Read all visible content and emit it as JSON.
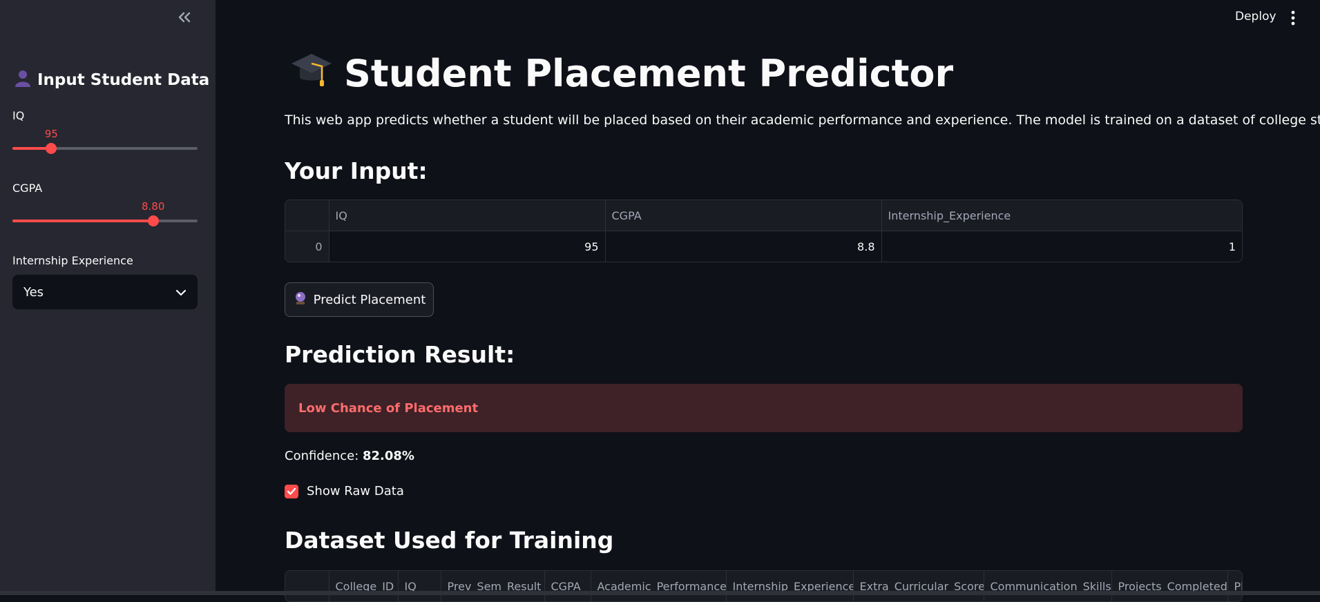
{
  "sidebar": {
    "title": "Input Student Data",
    "title_icon": "bust-silhouette-icon",
    "iq": {
      "label": "IQ",
      "value": "95",
      "fraction": 0.21
    },
    "cgpa": {
      "label": "CGPA",
      "value": "8.80",
      "fraction": 0.76
    },
    "internship": {
      "label": "Internship Experience",
      "selected": "Yes"
    }
  },
  "header": {
    "deploy_label": "Deploy"
  },
  "main": {
    "title": "Student Placement Predictor",
    "title_icon": "graduation-cap-icon",
    "description": "This web app predicts whether a student will be placed based on their academic performance and experience. The model is trained on a dataset of college students.",
    "input_heading": "Your Input:",
    "input_table": {
      "columns": [
        "IQ",
        "CGPA",
        "Internship_Experience"
      ],
      "rows": [
        {
          "index": "0",
          "cells": [
            "95",
            "8.8",
            "1"
          ]
        }
      ]
    },
    "predict_button": "Predict Placement",
    "predict_icon": "crystal-ball-icon",
    "result_heading": "Prediction Result:",
    "result_alert": "Low Chance of Placement",
    "confidence_label": "Confidence: ",
    "confidence_value": "82.08%",
    "show_raw_label": "Show Raw Data",
    "show_raw_checked": true,
    "dataset_heading": "Dataset Used for Training",
    "dataset_columns": [
      "College_ID",
      "IQ",
      "Prev_Sem_Result",
      "CGPA",
      "Academic_Performance",
      "Internship_Experience",
      "Extra_Curricular_Score",
      "Communication_Skills",
      "Projects_Completed",
      "Pla"
    ]
  },
  "colors": {
    "accent": "#ff4b4b",
    "background": "#0e1117",
    "sidebar": "#262730",
    "alert_bg": "#3e2227"
  }
}
